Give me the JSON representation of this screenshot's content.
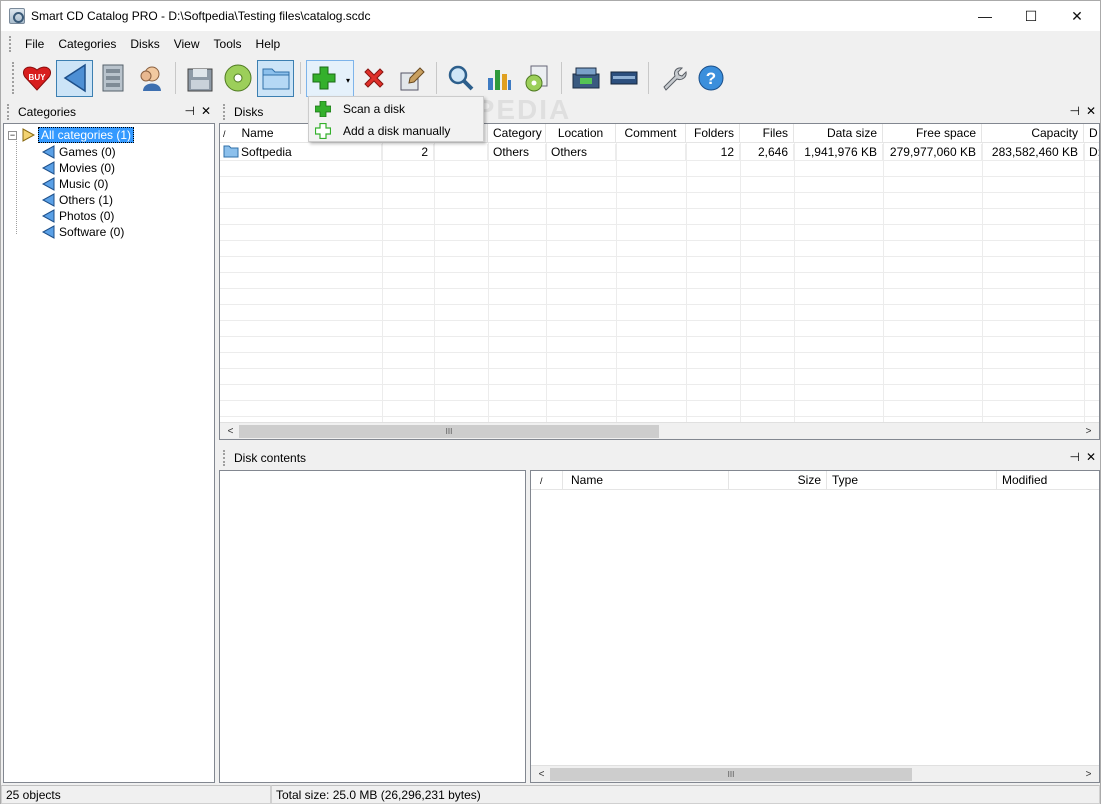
{
  "window": {
    "title": "Smart CD Catalog PRO - D:\\Softpedia\\Testing files\\catalog.scdc",
    "minimize": "—",
    "maximize": "☐",
    "close": "✕"
  },
  "menu": [
    "File",
    "Categories",
    "Disks",
    "View",
    "Tools",
    "Help"
  ],
  "toolbar": {
    "buttons": [
      "buy-icon",
      "categories-view-icon",
      "disks-view-icon",
      "contacts-icon",
      "scan-floppy-icon",
      "cd-disk-icon",
      "folder-icon",
      "add-plus-icon",
      "delete-x-icon",
      "properties-icon",
      "search-magnifier-icon",
      "statistics-chart-icon",
      "report-cd-icon",
      "scanner-icon",
      "drive-icon",
      "settings-wrench-icon",
      "help-question-icon"
    ],
    "dropdown_arrow": "▾"
  },
  "dropdown": {
    "items": [
      {
        "label": "Scan a disk",
        "icon": "plus-green-icon"
      },
      {
        "label": "Add a disk manually",
        "icon": "plus-outline-icon"
      }
    ]
  },
  "watermark": "SOFTPEDIA",
  "categories_panel": {
    "title": "Categories",
    "pin": "⊣",
    "close": "✕",
    "root": "All categories (1)",
    "expander": "−",
    "children": [
      "Games (0)",
      "Movies (0)",
      "Music (0)",
      "Others (1)",
      "Photos (0)",
      "Software (0)"
    ]
  },
  "disks_panel": {
    "title": "Disks",
    "pin": "⊣",
    "close": "✕",
    "sort_mark": "/",
    "columns": [
      "Name",
      "",
      "",
      "Category",
      "Location",
      "Comment",
      "Folders",
      "Files",
      "Data size",
      "Free space",
      "Capacity",
      "D"
    ],
    "rows": [
      {
        "name": "Softpedia",
        "col2": "2",
        "col3": "",
        "category": "Others",
        "location": "Others",
        "comment": "",
        "folders": "12",
        "files": "2,646",
        "data_size": "1,941,976 KB",
        "free_space": "279,977,060 KB",
        "capacity": "283,582,460 KB",
        "extra": "D:"
      }
    ],
    "scroll_thumb": "III",
    "scroll_left": "<",
    "scroll_right": ">"
  },
  "contents_panel": {
    "title": "Disk contents",
    "pin": "⊣",
    "close": "✕",
    "sort_mark": "/",
    "columns": [
      "Name",
      "Size",
      "Type",
      "Modified"
    ],
    "scroll_thumb": "III",
    "scroll_left": "<",
    "scroll_right": ">"
  },
  "status": {
    "objects": "25 objects",
    "total": "Total size: 25.0 MB (26,296,231 bytes)"
  }
}
